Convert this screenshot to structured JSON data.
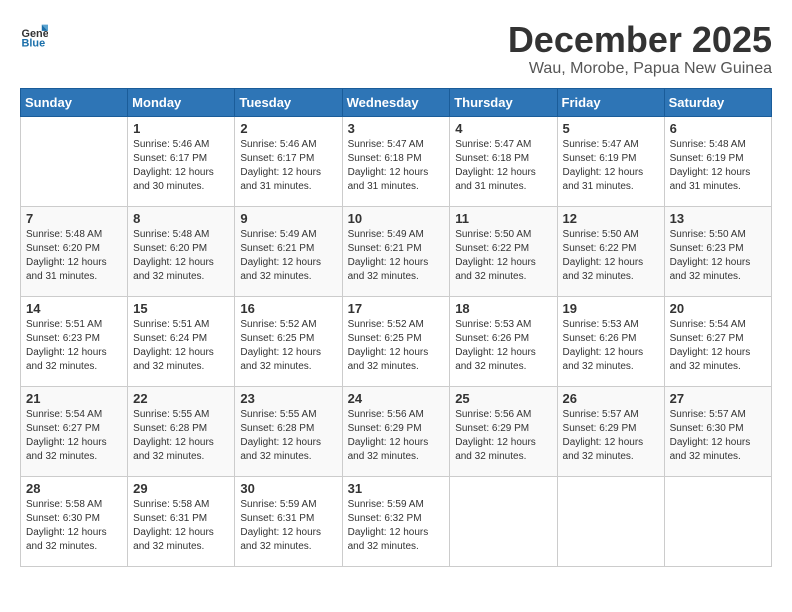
{
  "header": {
    "logo_general": "General",
    "logo_blue": "Blue",
    "month_title": "December 2025",
    "location": "Wau, Morobe, Papua New Guinea"
  },
  "calendar": {
    "days_of_week": [
      "Sunday",
      "Monday",
      "Tuesday",
      "Wednesday",
      "Thursday",
      "Friday",
      "Saturday"
    ],
    "weeks": [
      [
        {
          "day": "",
          "info": ""
        },
        {
          "day": "1",
          "info": "Sunrise: 5:46 AM\nSunset: 6:17 PM\nDaylight: 12 hours\nand 30 minutes."
        },
        {
          "day": "2",
          "info": "Sunrise: 5:46 AM\nSunset: 6:17 PM\nDaylight: 12 hours\nand 31 minutes."
        },
        {
          "day": "3",
          "info": "Sunrise: 5:47 AM\nSunset: 6:18 PM\nDaylight: 12 hours\nand 31 minutes."
        },
        {
          "day": "4",
          "info": "Sunrise: 5:47 AM\nSunset: 6:18 PM\nDaylight: 12 hours\nand 31 minutes."
        },
        {
          "day": "5",
          "info": "Sunrise: 5:47 AM\nSunset: 6:19 PM\nDaylight: 12 hours\nand 31 minutes."
        },
        {
          "day": "6",
          "info": "Sunrise: 5:48 AM\nSunset: 6:19 PM\nDaylight: 12 hours\nand 31 minutes."
        }
      ],
      [
        {
          "day": "7",
          "info": "Sunrise: 5:48 AM\nSunset: 6:20 PM\nDaylight: 12 hours\nand 31 minutes."
        },
        {
          "day": "8",
          "info": "Sunrise: 5:48 AM\nSunset: 6:20 PM\nDaylight: 12 hours\nand 32 minutes."
        },
        {
          "day": "9",
          "info": "Sunrise: 5:49 AM\nSunset: 6:21 PM\nDaylight: 12 hours\nand 32 minutes."
        },
        {
          "day": "10",
          "info": "Sunrise: 5:49 AM\nSunset: 6:21 PM\nDaylight: 12 hours\nand 32 minutes."
        },
        {
          "day": "11",
          "info": "Sunrise: 5:50 AM\nSunset: 6:22 PM\nDaylight: 12 hours\nand 32 minutes."
        },
        {
          "day": "12",
          "info": "Sunrise: 5:50 AM\nSunset: 6:22 PM\nDaylight: 12 hours\nand 32 minutes."
        },
        {
          "day": "13",
          "info": "Sunrise: 5:50 AM\nSunset: 6:23 PM\nDaylight: 12 hours\nand 32 minutes."
        }
      ],
      [
        {
          "day": "14",
          "info": "Sunrise: 5:51 AM\nSunset: 6:23 PM\nDaylight: 12 hours\nand 32 minutes."
        },
        {
          "day": "15",
          "info": "Sunrise: 5:51 AM\nSunset: 6:24 PM\nDaylight: 12 hours\nand 32 minutes."
        },
        {
          "day": "16",
          "info": "Sunrise: 5:52 AM\nSunset: 6:25 PM\nDaylight: 12 hours\nand 32 minutes."
        },
        {
          "day": "17",
          "info": "Sunrise: 5:52 AM\nSunset: 6:25 PM\nDaylight: 12 hours\nand 32 minutes."
        },
        {
          "day": "18",
          "info": "Sunrise: 5:53 AM\nSunset: 6:26 PM\nDaylight: 12 hours\nand 32 minutes."
        },
        {
          "day": "19",
          "info": "Sunrise: 5:53 AM\nSunset: 6:26 PM\nDaylight: 12 hours\nand 32 minutes."
        },
        {
          "day": "20",
          "info": "Sunrise: 5:54 AM\nSunset: 6:27 PM\nDaylight: 12 hours\nand 32 minutes."
        }
      ],
      [
        {
          "day": "21",
          "info": "Sunrise: 5:54 AM\nSunset: 6:27 PM\nDaylight: 12 hours\nand 32 minutes."
        },
        {
          "day": "22",
          "info": "Sunrise: 5:55 AM\nSunset: 6:28 PM\nDaylight: 12 hours\nand 32 minutes."
        },
        {
          "day": "23",
          "info": "Sunrise: 5:55 AM\nSunset: 6:28 PM\nDaylight: 12 hours\nand 32 minutes."
        },
        {
          "day": "24",
          "info": "Sunrise: 5:56 AM\nSunset: 6:29 PM\nDaylight: 12 hours\nand 32 minutes."
        },
        {
          "day": "25",
          "info": "Sunrise: 5:56 AM\nSunset: 6:29 PM\nDaylight: 12 hours\nand 32 minutes."
        },
        {
          "day": "26",
          "info": "Sunrise: 5:57 AM\nSunset: 6:29 PM\nDaylight: 12 hours\nand 32 minutes."
        },
        {
          "day": "27",
          "info": "Sunrise: 5:57 AM\nSunset: 6:30 PM\nDaylight: 12 hours\nand 32 minutes."
        }
      ],
      [
        {
          "day": "28",
          "info": "Sunrise: 5:58 AM\nSunset: 6:30 PM\nDaylight: 12 hours\nand 32 minutes."
        },
        {
          "day": "29",
          "info": "Sunrise: 5:58 AM\nSunset: 6:31 PM\nDaylight: 12 hours\nand 32 minutes."
        },
        {
          "day": "30",
          "info": "Sunrise: 5:59 AM\nSunset: 6:31 PM\nDaylight: 12 hours\nand 32 minutes."
        },
        {
          "day": "31",
          "info": "Sunrise: 5:59 AM\nSunset: 6:32 PM\nDaylight: 12 hours\nand 32 minutes."
        },
        {
          "day": "",
          "info": ""
        },
        {
          "day": "",
          "info": ""
        },
        {
          "day": "",
          "info": ""
        }
      ]
    ]
  }
}
